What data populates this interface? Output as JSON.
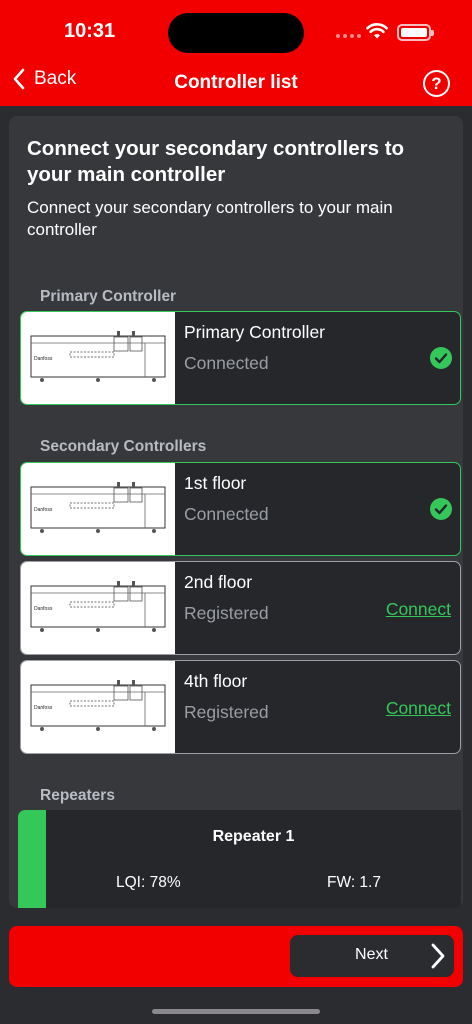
{
  "status_bar": {
    "time": "10:31"
  },
  "nav": {
    "back_label": "Back",
    "title": "Controller list",
    "help_label": "?"
  },
  "header": {
    "title": "Connect your secondary controllers to your main controller",
    "subtitle": "Connect your secondary controllers to your main controller"
  },
  "primary_section": {
    "label": "Primary Controller",
    "controller": {
      "name": "Primary Controller",
      "status": "Connected"
    }
  },
  "secondary_section": {
    "label": "Secondary Controllers",
    "controllers": [
      {
        "name": "1st floor",
        "status": "Connected"
      },
      {
        "name": "2nd floor",
        "status": "Registered",
        "action": "Connect"
      },
      {
        "name": "4th floor",
        "status": "Registered",
        "action": "Connect"
      }
    ]
  },
  "repeaters_section": {
    "label": "Repeaters",
    "repeater": {
      "name": "Repeater 1",
      "lqi": "LQI:  78%",
      "fw": "FW:  1.7"
    }
  },
  "footer": {
    "next_label": "Next"
  },
  "colors": {
    "brand": "#f20000",
    "success": "#34c759",
    "card_bg": "#25272b",
    "surface": "#36383c"
  },
  "icons": [
    "chevron-left-icon",
    "help-icon",
    "wifi-icon",
    "battery-icon",
    "checkmark-circle-icon",
    "chevron-right-icon"
  ]
}
